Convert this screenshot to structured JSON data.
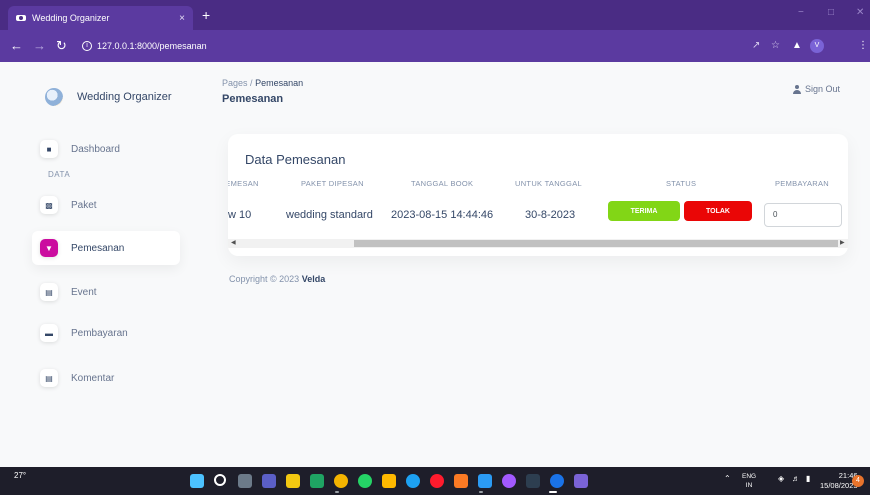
{
  "browser": {
    "tab_title": "Wedding Organizer",
    "tab_close": "×",
    "new_tab": "+",
    "url": "127.0.0.1:8000/pemesanan",
    "profile_initial": "V"
  },
  "sidebar": {
    "brand": "Wedding Organizer",
    "section_label": "DATA",
    "items": [
      {
        "label": "Dashboard",
        "icon": "store-icon"
      },
      {
        "label": "Paket",
        "icon": "chart-icon"
      },
      {
        "label": "Pemesanan",
        "icon": "cart-icon",
        "active": true
      },
      {
        "label": "Event",
        "icon": "calendar-icon"
      },
      {
        "label": "Pembayaran",
        "icon": "card-icon"
      },
      {
        "label": "Komentar",
        "icon": "calendar-icon"
      }
    ]
  },
  "header": {
    "breadcrumb_root": "Pages",
    "breadcrumb_sep": "/",
    "breadcrumb_current": "Pemesanan",
    "title": "Pemesanan",
    "sign_out": "Sign Out"
  },
  "table": {
    "title": "Data Pemesanan",
    "columns": [
      "PEMESAN",
      "PAKET DIPESAN",
      "TANGGAL BOOK",
      "UNTUK TANGGAL",
      "STATUS",
      "PEMBAYARAN"
    ],
    "rows": [
      {
        "pemesan": "w 10",
        "paket": "wedding standard",
        "tanggal_book": "2023-08-15 14:44:46",
        "untuk_tanggal": "30-8-2023",
        "accept_label": "TERIMA",
        "reject_label": "TOLAK",
        "pembayaran": "0"
      }
    ]
  },
  "footer": {
    "text": "Copyright © 2023",
    "author": "Velda"
  },
  "taskbar": {
    "weather": "27°",
    "lang_top": "ENG",
    "lang_bottom": "IN",
    "time": "21:46",
    "date": "15/08/2023",
    "notifications": "4"
  },
  "colors": {
    "primary": "#cb0c9f",
    "success": "#82d616",
    "danger": "#ea0606",
    "browser_frame": "#5b3aa0"
  }
}
